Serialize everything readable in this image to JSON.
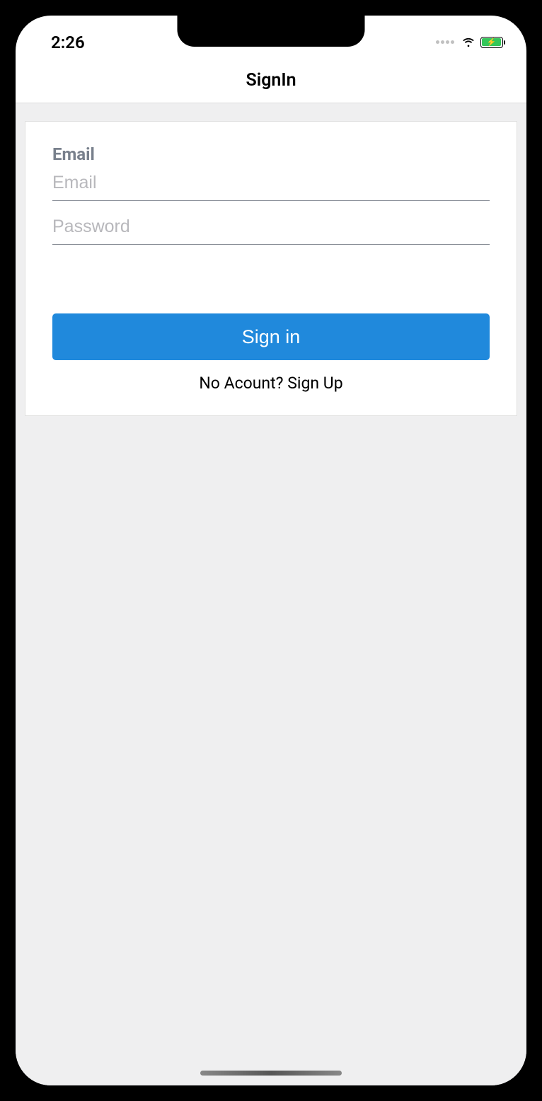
{
  "status": {
    "time": "2:26"
  },
  "header": {
    "title": "SignIn"
  },
  "form": {
    "email_label": "Email",
    "email_placeholder": "Email",
    "email_value": "",
    "password_placeholder": "Password",
    "password_value": "",
    "signin_button_label": "Sign in",
    "signup_link_label": "No Acount? Sign Up"
  },
  "colors": {
    "primary": "#2089dc",
    "background": "#efeff0",
    "battery_green": "#34c759"
  }
}
